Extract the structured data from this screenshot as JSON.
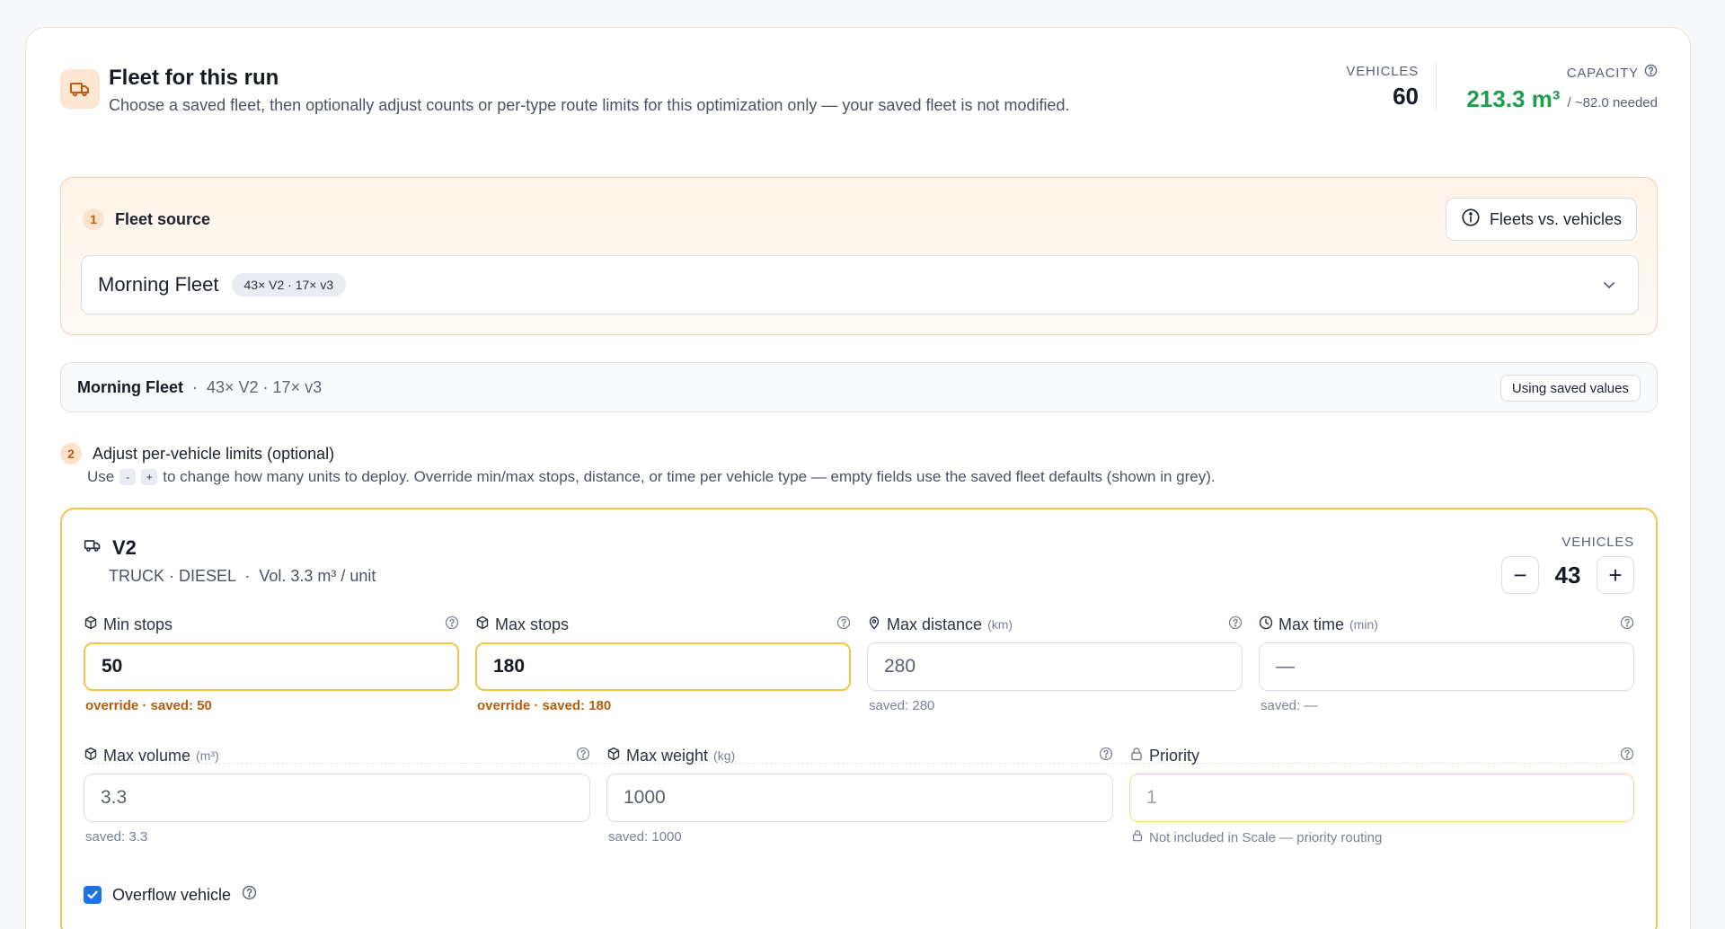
{
  "header": {
    "title": "Fleet for this run",
    "subtitle": "Choose a saved fleet, then optionally adjust counts or per-type route limits for this optimization only — your saved fleet is not modified.",
    "vehicles_label": "VEHICLES",
    "vehicles_value": "60",
    "capacity_label": "CAPACITY",
    "capacity_value": "213.3 m³",
    "capacity_needed": "/ ~82.0 needed"
  },
  "source": {
    "step": "1",
    "label": "Fleet source",
    "help_button": "Fleets vs. vehicles",
    "selected_fleet": "Morning Fleet",
    "selected_chip": "43× V2 · 17× v3"
  },
  "summary": {
    "fleet_name": "Morning Fleet",
    "separator": "·",
    "detail": "43× V2 · 17× v3",
    "status": "Using saved values"
  },
  "adjust": {
    "step": "2",
    "label": "Adjust per-vehicle limits (optional)",
    "help_prefix": "Use",
    "minus": "-",
    "plus": "+",
    "help_suffix": "to change how many units to deploy. Override min/max stops, distance, or time per vehicle type — empty fields use the saved fleet defaults (shown in grey)."
  },
  "vehicle": {
    "name": "V2",
    "meta": "TRUCK · DIESEL  ·  Vol. 3.3 m³ / unit",
    "count_label": "VEHICLES",
    "count": "43",
    "minus": "−",
    "plus": "+",
    "fields": {
      "min_stops": {
        "label": "Min stops",
        "unit": "",
        "value": "50",
        "note": "override · saved: 50"
      },
      "max_stops": {
        "label": "Max stops",
        "unit": "",
        "value": "180",
        "note": "override · saved: 180"
      },
      "max_distance": {
        "label": "Max distance",
        "unit": "(km)",
        "value": "280",
        "note": "saved: 280"
      },
      "max_time": {
        "label": "Max time",
        "unit": "(min)",
        "value": "—",
        "note": "saved: —"
      },
      "max_volume": {
        "label": "Max volume",
        "unit": "(m³)",
        "value": "3.3",
        "note": "saved: 3.3"
      },
      "max_weight": {
        "label": "Max weight",
        "unit": "(kg)",
        "value": "1000",
        "note": "saved: 1000"
      },
      "priority": {
        "label": "Priority",
        "unit": "",
        "value": "1",
        "note": "Not included in Scale — priority routing"
      }
    },
    "overflow_label": "Overflow vehicle",
    "overflow_checked": true
  },
  "colors": {
    "accent_orange": "#c25a12",
    "override_border": "#f5c24a",
    "capacity_green": "#1f9d4e",
    "checkbox_blue": "#1a73e8"
  }
}
